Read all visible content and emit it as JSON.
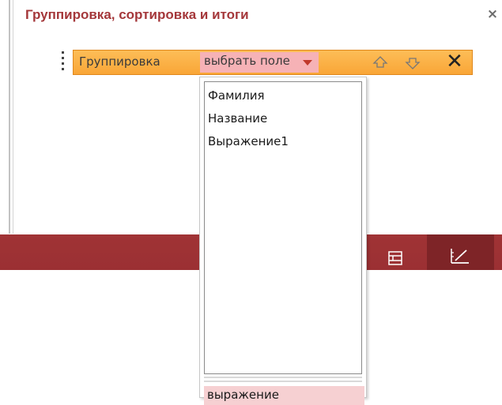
{
  "panel": {
    "title": "Группировка, сортировка и итоги",
    "close_label": "×"
  },
  "group_row": {
    "label": "Группировка",
    "field_select": {
      "value": "выбрать поле",
      "icon": "dropdown-triangle-icon"
    },
    "move_up_icon": "arrow-up-icon",
    "move_down_icon": "arrow-down-icon",
    "delete_label": "✕"
  },
  "dropdown": {
    "items": [
      "Фамилия",
      "Название",
      "Выражение1"
    ],
    "expression_option": "выражение"
  },
  "status_bar": {
    "buttons": [
      "layout-view-icon",
      "design-view-icon"
    ]
  },
  "colors": {
    "title": "#a4373a",
    "group_bar": "#f9a637",
    "field_select": "#f6b2b6",
    "status_bar": "#9e3134",
    "status_active": "#7e2427",
    "expression_bg": "#f6d0d2"
  }
}
